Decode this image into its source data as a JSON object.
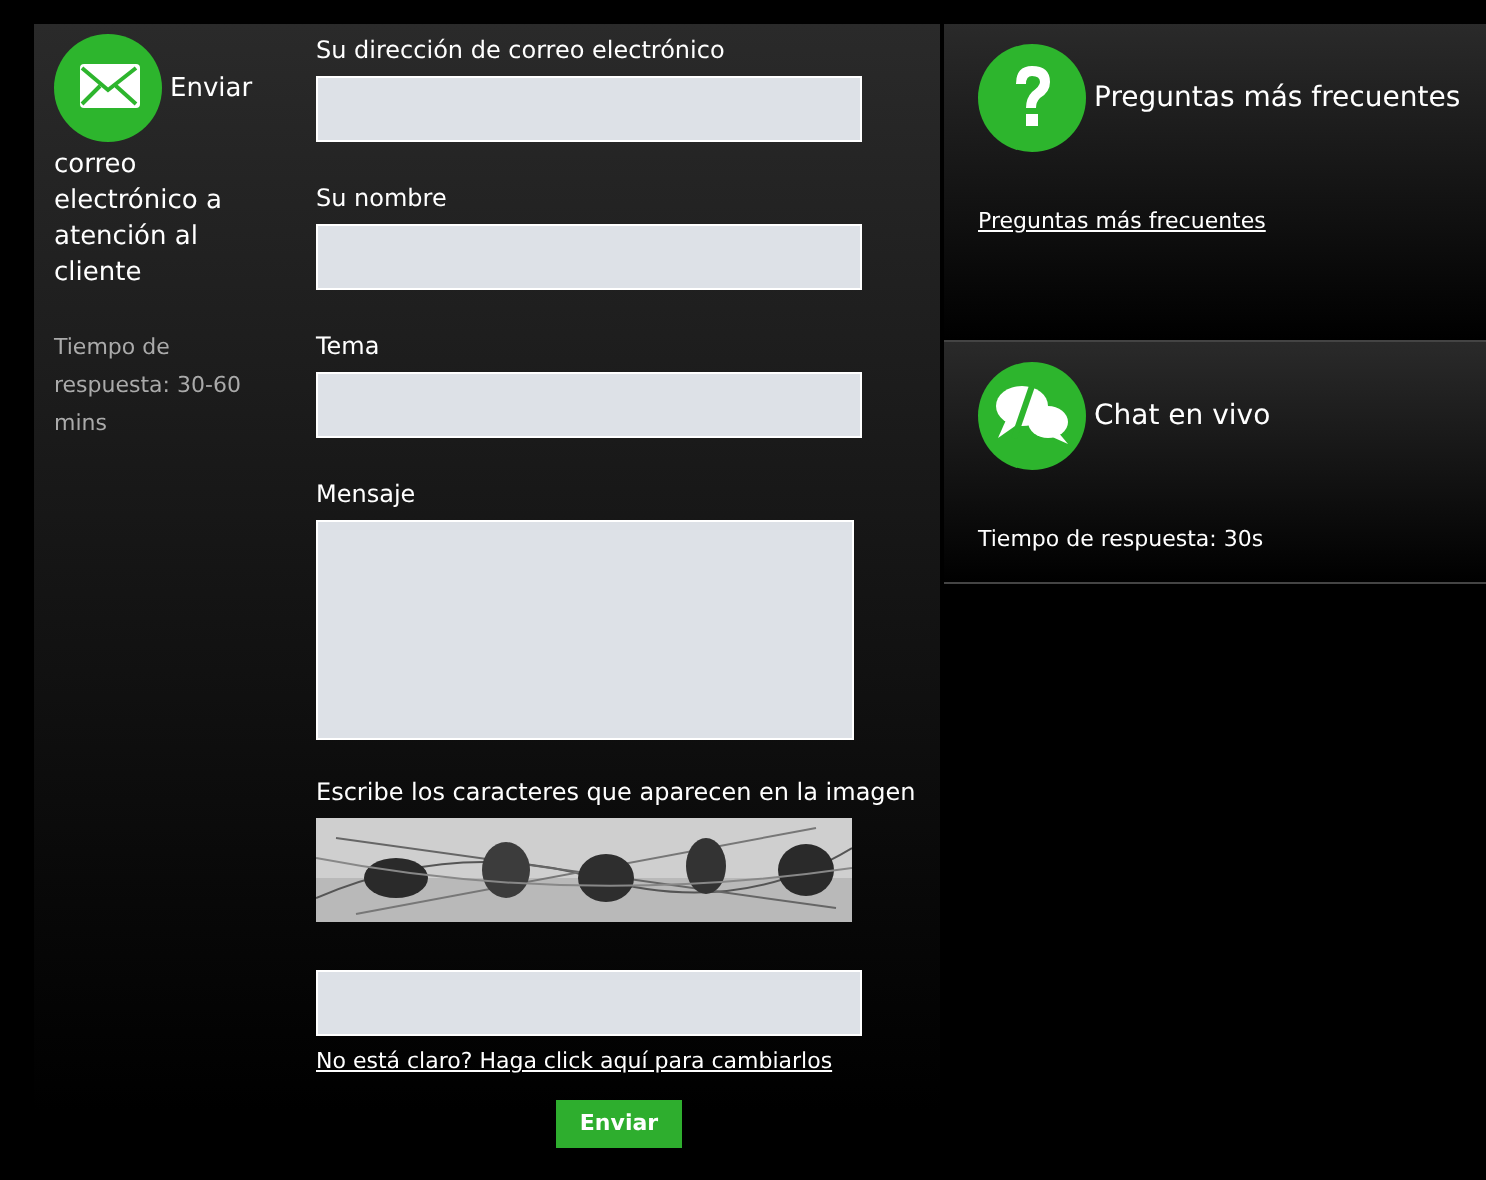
{
  "email_panel": {
    "title_lines": [
      "Enviar",
      "correo electrónico a atención al cliente"
    ],
    "response_time": "Tiempo de respuesta: 30-60 mins"
  },
  "form": {
    "fields": [
      {
        "kind": "input",
        "label": "Su dirección de correo electrónico"
      },
      {
        "kind": "input",
        "label": "Su nombre"
      },
      {
        "kind": "input",
        "label": "Tema"
      },
      {
        "kind": "textarea",
        "label": "Mensaje"
      }
    ],
    "captcha": {
      "label": "Escribe los caracteres que aparecen en la imagen",
      "refresh_link": "No está claro? Haga click aquí para cambiarlos"
    },
    "submit": "Enviar"
  },
  "faq_panel": {
    "title": "Preguntas más frecuentes",
    "link": "Preguntas más frecuentes"
  },
  "chat_panel": {
    "title": "Chat en vivo",
    "response_time": "Tiempo de respuesta: 30s"
  }
}
